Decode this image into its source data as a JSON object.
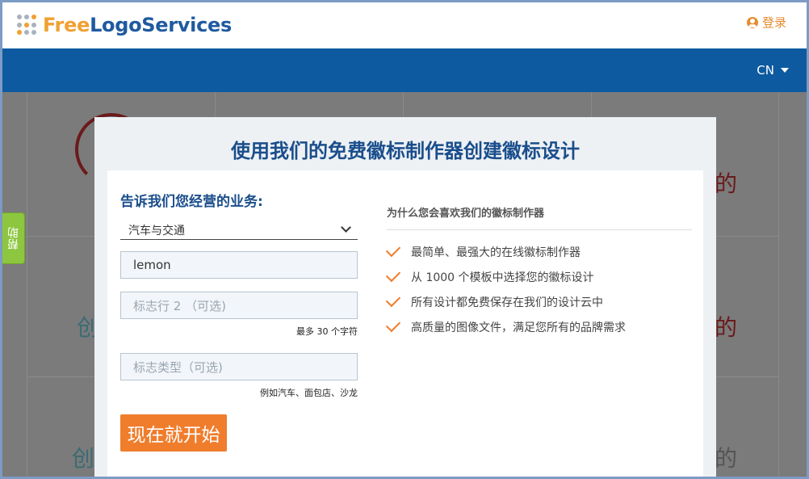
{
  "header": {
    "logo_free": "Free",
    "logo_rest": "LogoServices",
    "login_label": "登录"
  },
  "nav": {
    "language": "CN"
  },
  "help_tab": {
    "label": "帮助"
  },
  "modal": {
    "title": "使用我们的免费徽标制作器创建徽标设计",
    "form": {
      "heading": "告诉我们您经营的业务:",
      "industry_selected": "汽车与交通",
      "logo_name_value": "lemon",
      "tagline_placeholder": "标志行 2 （可选)",
      "tagline_hint": "最多 30 个字符",
      "logo_type_placeholder": "标志类型（可选)",
      "logo_type_hint": "例如汽车、面包店、沙龙",
      "start_button": "现在就开始"
    },
    "reasons": {
      "heading": "为什么您会喜欢我们的徽标制作器",
      "items": [
        "最简单、最强大的在线徽标制作器",
        "从 1000 个模板中选择您的徽标设计",
        "所有设计都免费保存在我们的设计云中",
        "高质量的图像文件，满足您所有的品牌需求"
      ]
    }
  },
  "background_glyphs": [
    "创",
    "的",
    "创",
    "的",
    "创",
    "的"
  ],
  "colors": {
    "brand_blue": "#0d5aa0",
    "accent_orange": "#ef7d2c",
    "help_green": "#8dc63f"
  }
}
